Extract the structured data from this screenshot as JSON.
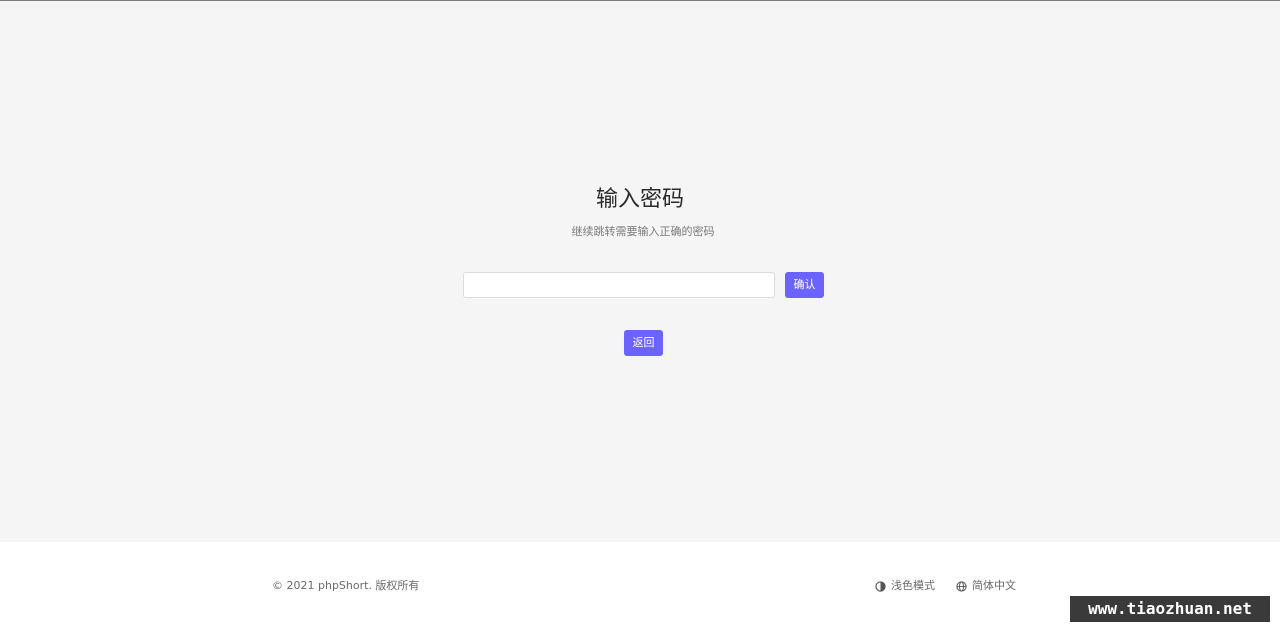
{
  "main": {
    "title": "输入密码",
    "subtitle": "继续跳转需要输入正确的密码",
    "password_input": {
      "value": "",
      "placeholder": ""
    },
    "confirm_label": "确认",
    "back_label": "返回"
  },
  "footer": {
    "copyright": "© 2021 phpShort. 版权所有",
    "theme_label": "浅色模式",
    "theme_icon": "contrast-icon",
    "language_label": "简体中文",
    "language_icon": "globe-icon"
  },
  "watermark": "www.tiaozhuan.net",
  "colors": {
    "accent": "#6c63ff",
    "page_background": "#f5f5f5",
    "footer_background": "#ffffff"
  }
}
